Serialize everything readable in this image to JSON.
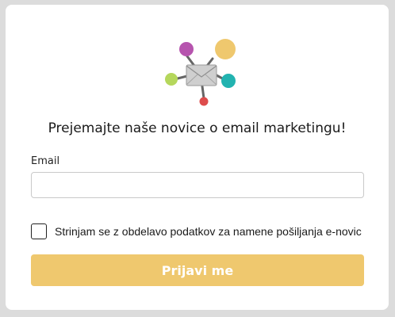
{
  "title": "Prejemajte naše novice o email marketingu!",
  "email": {
    "label": "Email",
    "value": "",
    "placeholder": ""
  },
  "consent": {
    "checked": false,
    "text": "Strinjam se z obdelavo podatkov za namene pošiljanja e-novic"
  },
  "submit_label": "Prijavi me",
  "colors": {
    "page_bg": "#dcdcdc",
    "card_bg": "#ffffff",
    "button": "#efc86e",
    "button_text": "#ffffff",
    "logo_purple": "#b654ae",
    "logo_yellow": "#efc86e",
    "logo_teal": "#22b3b0",
    "logo_green": "#b5d75c",
    "logo_red": "#dd4c4c",
    "logo_envelope": "#cfcfcf",
    "logo_connector": "#666666"
  }
}
